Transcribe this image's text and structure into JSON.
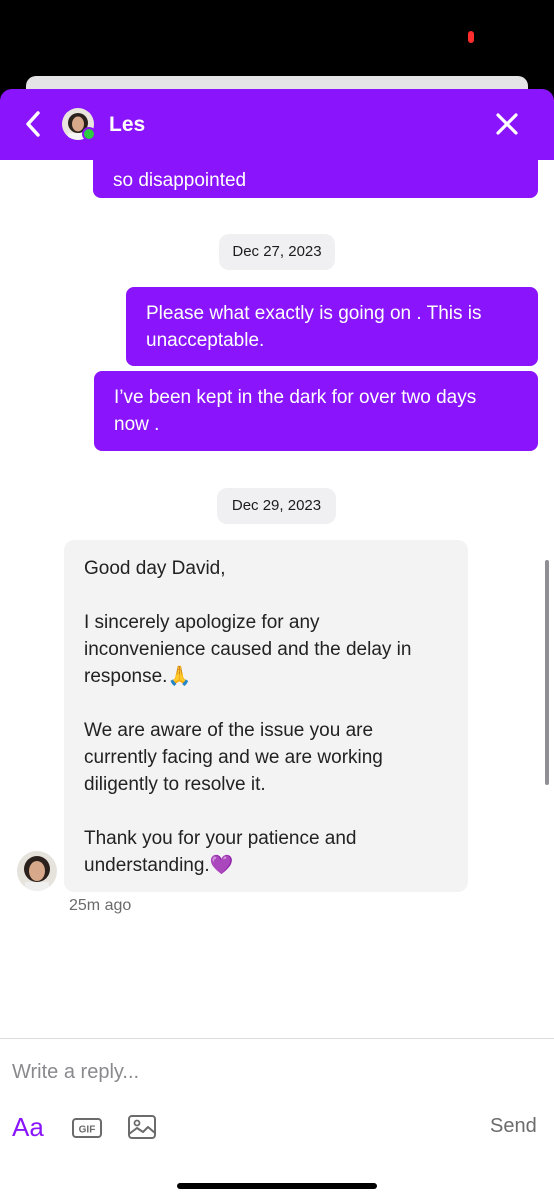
{
  "header": {
    "contact_name": "Les",
    "accent_color": "#8a14fb",
    "online_color": "#2ecc40"
  },
  "messages": {
    "partial_top": {
      "text": "so disappointed"
    },
    "date_1": "Dec 27, 2023",
    "outgoing_1": {
      "line1": "Please what exactly is going on . This is",
      "line2": "unacceptable."
    },
    "outgoing_2": {
      "line1": "I’ve been kept in the dark for over two days",
      "line2": "now ."
    },
    "date_2": "Dec 29, 2023",
    "incoming": {
      "greeting": "Good day David,",
      "para1_l1": "I sincerely apologize for any",
      "para1_l2": "inconvenience caused and the delay in",
      "para1_l3": "response.🙏",
      "para2_l1": "We are aware of the issue you are",
      "para2_l2": "currently facing and we are working",
      "para2_l3": "diligently to resolve it.",
      "para3_l1": "Thank you for your patience and",
      "para3_l2": "understanding.💜",
      "timestamp": "25m ago"
    }
  },
  "composer": {
    "placeholder": "Write a reply...",
    "format_label": "Aa",
    "gif_label": "GIF",
    "send_label": "Send",
    "icons": [
      "gif-icon",
      "image-icon"
    ]
  }
}
